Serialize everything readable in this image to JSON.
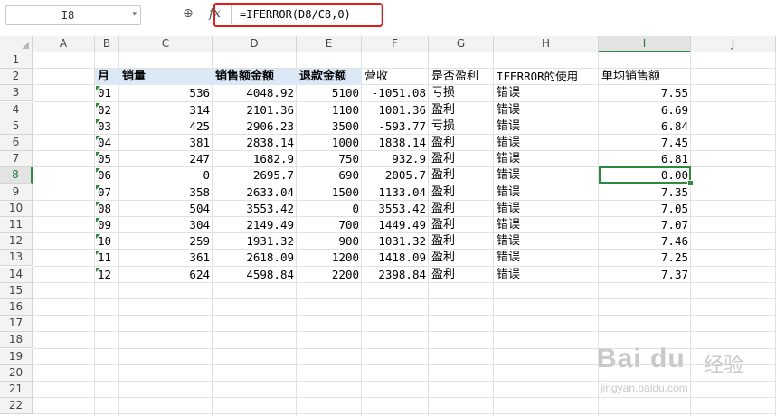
{
  "formula_bar": {
    "cell_ref": "I8",
    "formula": "=IFERROR(D8/C8,0)",
    "zoom_icon": "zoom-icon",
    "fx_label": "fx"
  },
  "columns": [
    "A",
    "B",
    "C",
    "D",
    "E",
    "F",
    "G",
    "H",
    "I",
    "J"
  ],
  "active_column": "I",
  "rows": [
    "1",
    "2",
    "3",
    "4",
    "5",
    "6",
    "7",
    "8",
    "9",
    "10",
    "11",
    "12",
    "13",
    "14",
    "15",
    "16",
    "17",
    "18",
    "19",
    "20",
    "21",
    "22"
  ],
  "active_row": "8",
  "table": {
    "headers": {
      "month": "月",
      "sales": "销量",
      "sales_amount": "销售额金额",
      "refund_amount": "退款金额",
      "revenue": "营收",
      "is_profit": "是否盈利",
      "iferror_use": "IFERROR的使用",
      "unit_sales": "单均销售额"
    },
    "rows": [
      {
        "month": "01",
        "sales": "536",
        "sales_amount": "4048.92",
        "refund": "5100",
        "revenue": "-1051.08",
        "profit": "亏损",
        "iferror": "错误",
        "unit": "7.55"
      },
      {
        "month": "02",
        "sales": "314",
        "sales_amount": "2101.36",
        "refund": "1100",
        "revenue": "1001.36",
        "profit": "盈利",
        "iferror": "错误",
        "unit": "6.69"
      },
      {
        "month": "03",
        "sales": "425",
        "sales_amount": "2906.23",
        "refund": "3500",
        "revenue": "-593.77",
        "profit": "亏损",
        "iferror": "错误",
        "unit": "6.84"
      },
      {
        "month": "04",
        "sales": "381",
        "sales_amount": "2838.14",
        "refund": "1000",
        "revenue": "1838.14",
        "profit": "盈利",
        "iferror": "错误",
        "unit": "7.45"
      },
      {
        "month": "05",
        "sales": "247",
        "sales_amount": "1682.9",
        "refund": "750",
        "revenue": "932.9",
        "profit": "盈利",
        "iferror": "错误",
        "unit": "6.81"
      },
      {
        "month": "06",
        "sales": "0",
        "sales_amount": "2695.7",
        "refund": "690",
        "revenue": "2005.7",
        "profit": "盈利",
        "iferror": "错误",
        "unit": "0.00"
      },
      {
        "month": "07",
        "sales": "358",
        "sales_amount": "2633.04",
        "refund": "1500",
        "revenue": "1133.04",
        "profit": "盈利",
        "iferror": "错误",
        "unit": "7.35"
      },
      {
        "month": "08",
        "sales": "504",
        "sales_amount": "3553.42",
        "refund": "0",
        "revenue": "3553.42",
        "profit": "盈利",
        "iferror": "错误",
        "unit": "7.05"
      },
      {
        "month": "09",
        "sales": "304",
        "sales_amount": "2149.49",
        "refund": "700",
        "revenue": "1449.49",
        "profit": "盈利",
        "iferror": "错误",
        "unit": "7.07"
      },
      {
        "month": "10",
        "sales": "259",
        "sales_amount": "1931.32",
        "refund": "900",
        "revenue": "1031.32",
        "profit": "盈利",
        "iferror": "错误",
        "unit": "7.46"
      },
      {
        "month": "11",
        "sales": "361",
        "sales_amount": "2618.09",
        "refund": "1200",
        "revenue": "1418.09",
        "profit": "盈利",
        "iferror": "错误",
        "unit": "7.25"
      },
      {
        "month": "12",
        "sales": "624",
        "sales_amount": "4598.84",
        "refund": "2200",
        "revenue": "2398.84",
        "profit": "盈利",
        "iferror": "错误",
        "unit": "7.37"
      }
    ]
  },
  "colors": {
    "highlight": "#e21c1c",
    "selection": "#2e8b3e",
    "header_band": "#dbe8f6"
  },
  "watermark": {
    "logo": "Bai du",
    "cn": "经验",
    "url": "jingyan.baidu.com"
  }
}
